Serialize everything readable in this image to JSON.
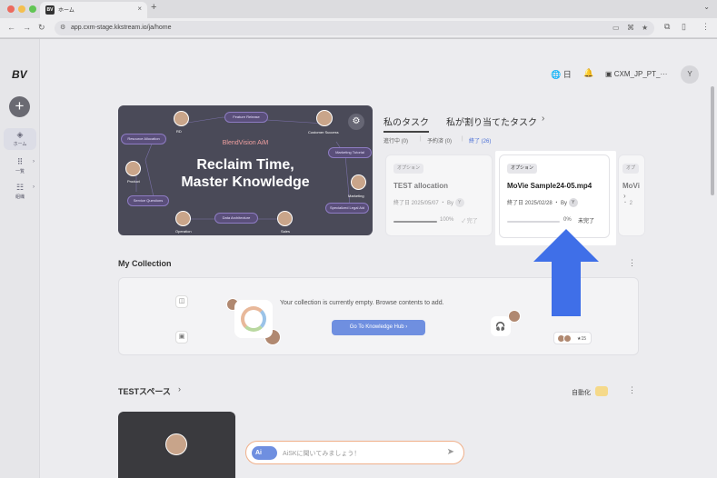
{
  "browser": {
    "tab_title": "ホーム",
    "tab_logo": "BV",
    "url": "app.cxm-stage.kkstream.io/ja/home"
  },
  "sidebar": {
    "logo": "BV",
    "items": [
      {
        "label": "ホーム",
        "icon": "home-icon"
      },
      {
        "label": "一覧",
        "icon": "grid-icon"
      },
      {
        "label": "組織",
        "icon": "org-icon"
      }
    ]
  },
  "header": {
    "language": "日",
    "workspace": "CXM_JP_PT_···",
    "avatar": "Y"
  },
  "hero": {
    "brand": "BlendVision AiM",
    "title_line1": "Reclaim Time,",
    "title_line2": "Master Knowledge",
    "pills": [
      "Feature Release",
      "Resource Allocation",
      "Marketing Tutorial",
      "Service Questions",
      "Data Architecture",
      "Specialized Legal Aid"
    ],
    "people": [
      "RD",
      "Customer Success",
      "Product",
      "Marketing",
      "Operation",
      "Sales"
    ]
  },
  "tasks": {
    "tab_mine": "私のタスク",
    "tab_assigned": "私が割り当てたタスク",
    "filters": {
      "in_progress": "進行中 (0)",
      "scheduled": "予約済 (0)",
      "done": "終了 (26)"
    },
    "cards": [
      {
        "badge": "オプション",
        "title": "TEST allocation",
        "meta": "終了日 2025/05/07 ・ By",
        "by": "Y",
        "percent": "100%",
        "progress": 1.0,
        "status": "✓ 完了"
      },
      {
        "badge": "オプション",
        "title": "MoVie Sample24-05.mp4",
        "meta": "終了日 2025/02/28 ・ By",
        "by": "Y",
        "percent": "0%",
        "progress": 0.0,
        "status": "未完了"
      },
      {
        "badge": "オプ",
        "title": "MoVi",
        "meta": "・ 2",
        "by": "",
        "percent": "",
        "progress": 0.0,
        "status": ""
      }
    ]
  },
  "collection": {
    "title": "My Collection",
    "empty_text": "Your collection is currently empty. Browse contents to add.",
    "button": "Go To Knowledge Hub",
    "count": "15"
  },
  "space": {
    "title": "TESTスペース",
    "auto_label": "自動化"
  },
  "ask": {
    "ai_label": "Ai",
    "placeholder": "AiSKに聞いてみましょう！"
  },
  "colors": {
    "accent": "#6f8fe0",
    "arrow": "#3f6fe8",
    "hero_bg": "#4a4a58"
  }
}
